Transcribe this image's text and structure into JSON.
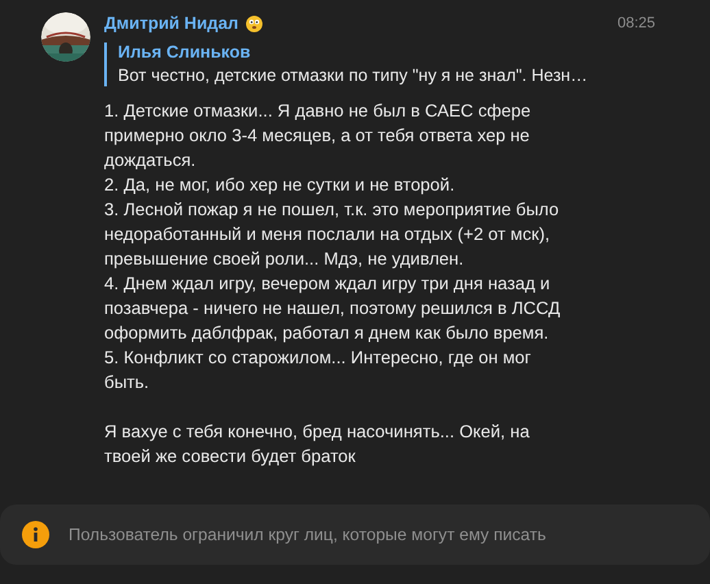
{
  "message": {
    "author": "Дмитрий Нидал",
    "time": "08:25",
    "reply": {
      "author": "Илья Слиньков",
      "text": "Вот честно, детские отмазки по типу \"ну я не знал\". Незн…"
    },
    "points": [
      "1. Детские отмазки... Я давно не был в САЕС сфере примерно окло 3-4 месяцев, а от тебя ответа хер не дождаться.",
      "2. Да, не мог, ибо хер не сутки и не второй.",
      "3. Лесной пожар я не пошел, т.к. это мероприятие было недоработанный и меня послали на отдых (+2 от мск), превышение своей роли... Мдэ, не удивлен.",
      "4. Днем ждал игру, вечером ждал игру три дня назад и позавчера - ничего не нашел, поэтому решился в ЛССД оформить даблфрак, работал я днем как было время.",
      "5. Конфликт со старожилом... Интересно, где он мог быть."
    ],
    "closing": "Я вахуе с тебя конечно, бред насочинять... Окей, на твоей же совести будет браток"
  },
  "notice": {
    "text": "Пользователь ограничил круг лиц, которые могут ему писать"
  }
}
